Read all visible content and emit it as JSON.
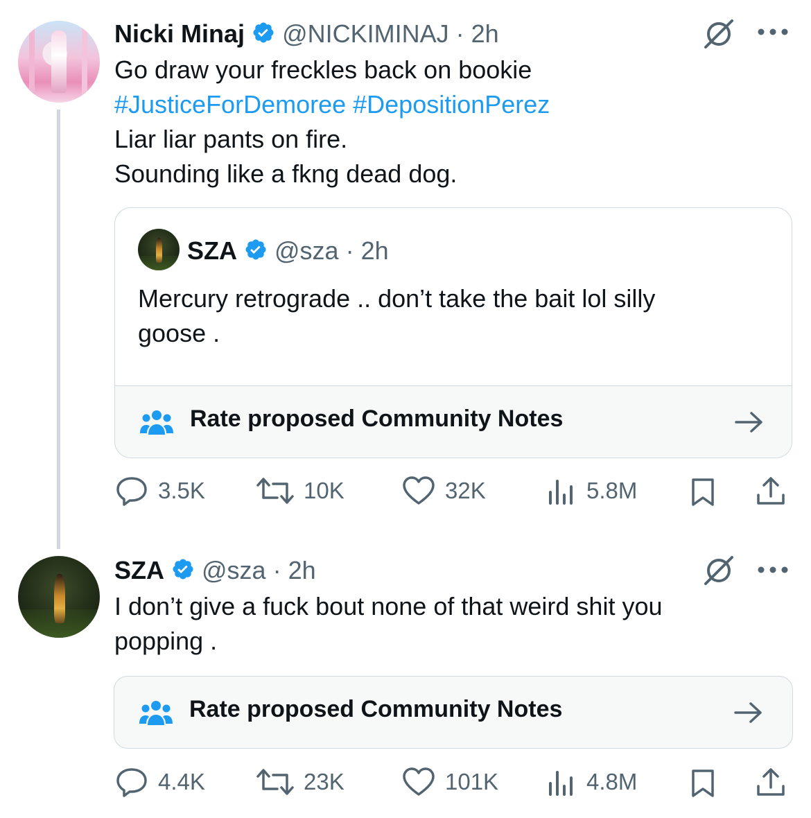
{
  "tweet1": {
    "name": "Nicki Minaj",
    "handle": "@NICKIMINAJ",
    "time": "· 2h",
    "lines": [
      "Go draw your freckles back on bookie"
    ],
    "hashtags": [
      "#JusticeForDemoree",
      "#DepositionPerez"
    ],
    "lines2": [
      "Liar liar pants on fire.",
      "Sounding like a fkng dead dog."
    ],
    "quote": {
      "name": "SZA",
      "handle": "@sza",
      "time": "· 2h",
      "text": [
        "Mercury retrograde .. don’t take the bait lol silly",
        "goose ."
      ],
      "notes_label": "Rate proposed Community Notes"
    },
    "actions": {
      "replies": "3.5K",
      "reposts": "10K",
      "likes": "32K",
      "views": "5.8M"
    }
  },
  "tweet2": {
    "name": "SZA",
    "handle": "@sza",
    "time": "· 2h",
    "text": [
      "I don’t give a fuck bout none of that weird shit you",
      "popping ."
    ],
    "notes_label": "Rate proposed Community Notes",
    "actions": {
      "replies": "4.4K",
      "reposts": "23K",
      "likes": "101K",
      "views": "4.8M"
    }
  },
  "colors": {
    "accent": "#1d9bf0",
    "text": "#0f1419",
    "muted": "#536471",
    "border": "#cfd9de"
  },
  "icons": [
    "verified-badge-icon",
    "grok-icon",
    "more-icon",
    "reply-icon",
    "repost-icon",
    "like-icon",
    "views-icon",
    "bookmark-icon",
    "share-icon",
    "community-notes-icon",
    "arrow-right-icon"
  ]
}
